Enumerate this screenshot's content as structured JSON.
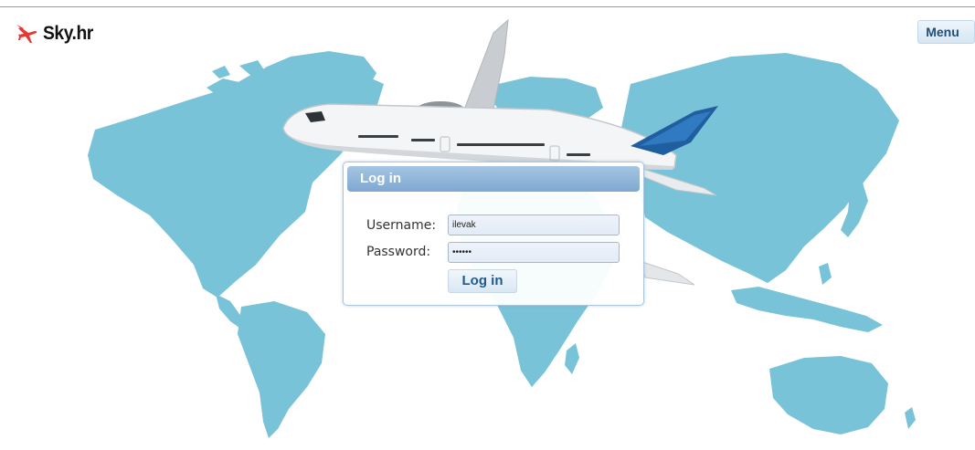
{
  "header": {
    "logo_text": "Sky.hr",
    "logo_icon": "airplane-icon",
    "menu_label": "Menu"
  },
  "background": {
    "map_color": "#79c3d8",
    "plane_accent": "#1f5f9f"
  },
  "login": {
    "title": "Log in",
    "username_label": "Username:",
    "username_value": "ilevak",
    "password_label": "Password:",
    "password_value": "••••••",
    "submit_label": "Log in"
  }
}
